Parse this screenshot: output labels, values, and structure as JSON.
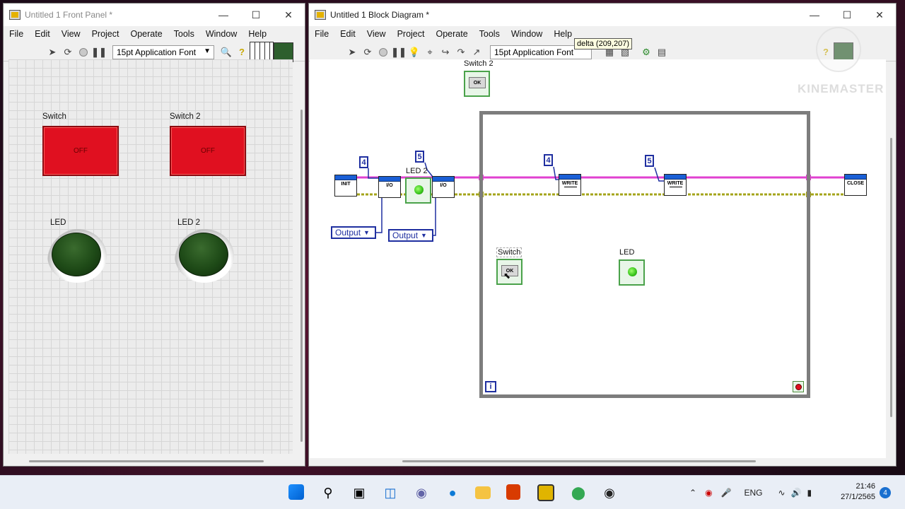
{
  "front_panel": {
    "title": "Untitled 1 Front Panel *",
    "menu": [
      "File",
      "Edit",
      "View",
      "Project",
      "Operate",
      "Tools",
      "Window",
      "Help"
    ],
    "font_select": "15pt Application Font",
    "controls": {
      "switch1_label": "Switch",
      "switch1_text": "OFF",
      "switch2_label": "Switch 2",
      "switch2_text": "OFF",
      "led1_label": "LED",
      "led2_label": "LED 2"
    }
  },
  "block_diagram": {
    "title": "Untitled 1 Block Diagram *",
    "menu": [
      "File",
      "Edit",
      "View",
      "Project",
      "Operate",
      "Tools",
      "Window",
      "Help"
    ],
    "font_select": "15pt Application Font",
    "tooltip": "delta (209,207)",
    "labels": {
      "switch2": "Switch 2",
      "led2": "LED 2",
      "switch": "Switch",
      "led": "LED",
      "output1": "Output",
      "output2": "Output",
      "const_4a": "4",
      "const_5a": "5",
      "const_4b": "4",
      "const_5b": "5",
      "iter": "i",
      "vi_init": "INIT",
      "vi_io1": "I/O",
      "vi_io2": "I/O",
      "vi_write1": "WRITE",
      "vi_write2": "WRITE",
      "vi_close": "CLOSE",
      "ok1": "OK",
      "ok2": "OK"
    }
  },
  "watermark": "KINEMASTER",
  "taskbar": {
    "language": "ENG",
    "time": "21:46",
    "date": "27/1/2565",
    "notification_count": "4"
  },
  "colors": {
    "switch_off": "#e01020",
    "led_off": "#1e4a17",
    "wire_pink": "#e040d0",
    "wire_green": "#a4a41a",
    "loop_border": "#7d7d7d",
    "subvi_header": "#1a5fd6"
  }
}
